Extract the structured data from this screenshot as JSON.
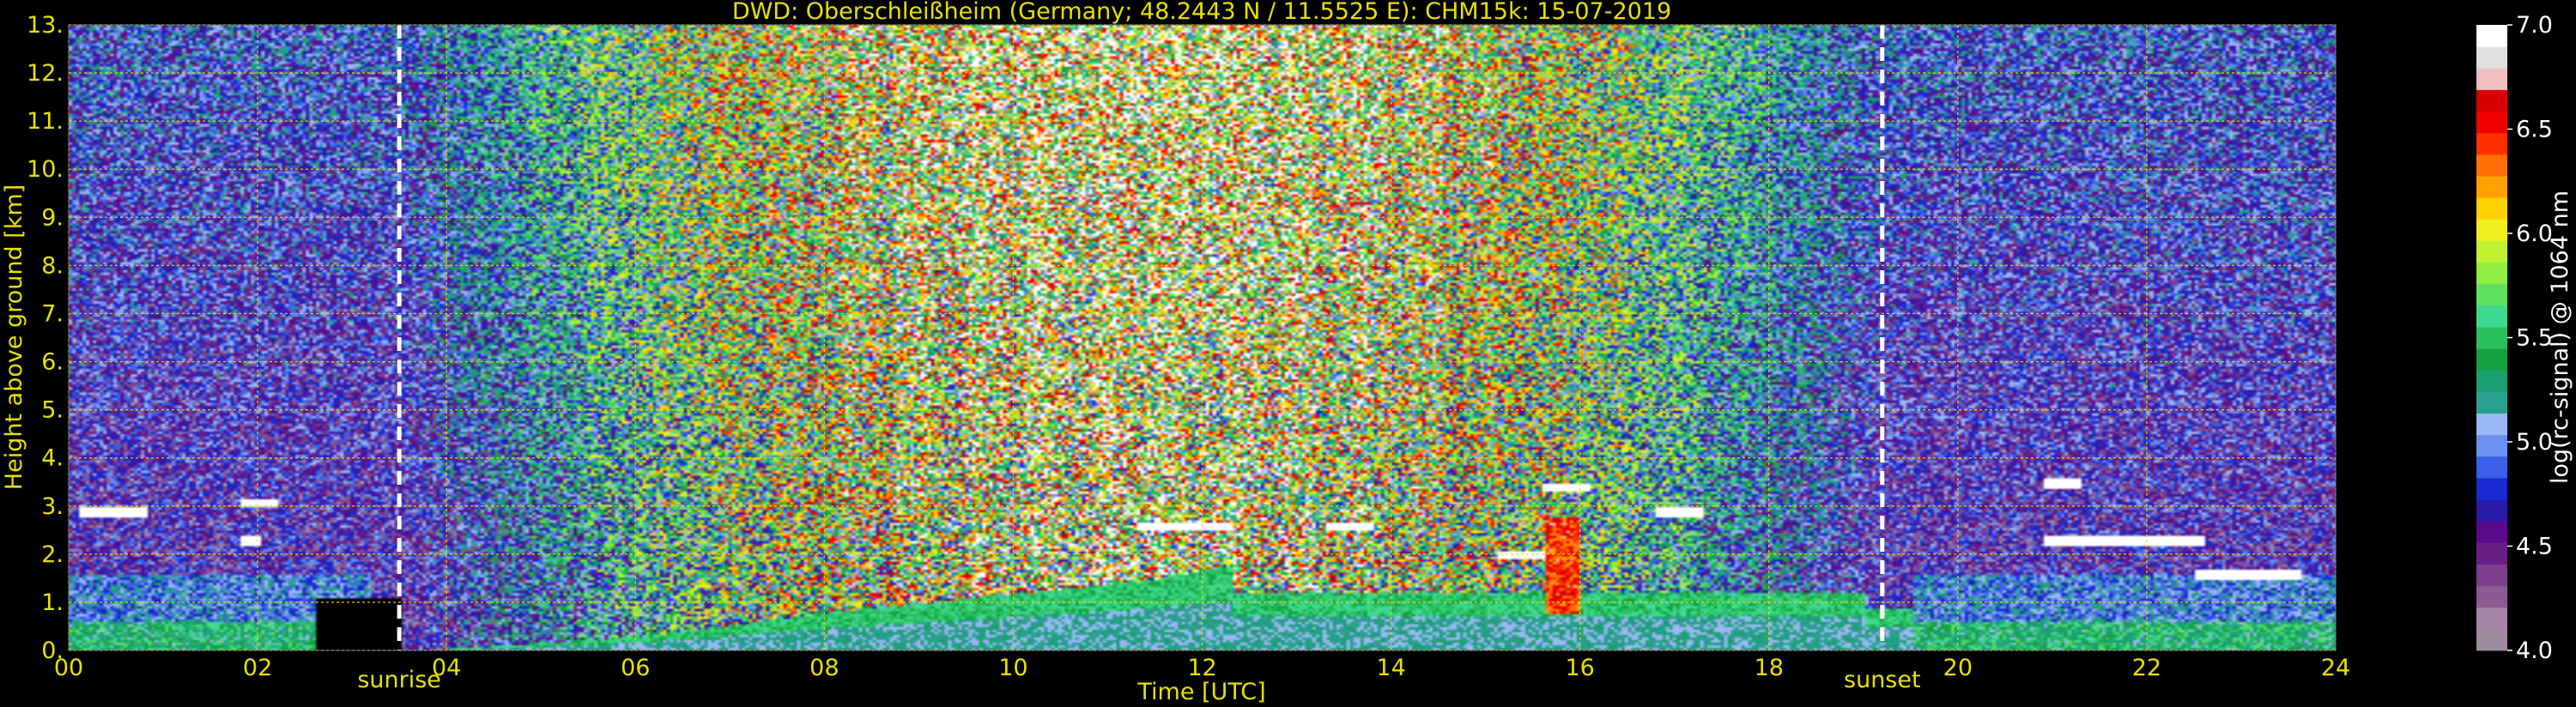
{
  "chart_data": [
    {
      "type": "heatmap",
      "title": "DWD: Oberschleißheim (Germany; 48.2443 N / 11.5525 E):    CHM15k: 15-07-2019",
      "xlabel": "Time [UTC]",
      "ylabel": "Height above ground [km]",
      "xlim": [
        0,
        24
      ],
      "ylim": [
        0,
        13
      ],
      "x_ticks": [
        "00",
        "02",
        "04",
        "06",
        "08",
        "10",
        "12",
        "14",
        "16",
        "18",
        "20",
        "22",
        "24"
      ],
      "y_ticks": [
        "0.",
        "1.",
        "2.",
        "3.",
        "4.",
        "5.",
        "6.",
        "7.",
        "8.",
        "9.",
        "10.",
        "11.",
        "12.",
        "13."
      ],
      "grid": true,
      "grid_color": "#e8e000",
      "markers": [
        {
          "label": "sunrise",
          "time": 3.5
        },
        {
          "label": "sunset",
          "time": 19.2
        }
      ],
      "colorbar": {
        "label": "log(rc-signal) @ 1064 nm",
        "range": [
          4.0,
          7.0
        ],
        "ticks": [
          "4.0",
          "4.5",
          "5.0",
          "5.5",
          "6.0",
          "6.5",
          "7.0"
        ],
        "colors": [
          "#9e8a9c",
          "#a685a6",
          "#8c5a93",
          "#7d3f8c",
          "#6a1f86",
          "#5a0a8a",
          "#2a1aa8",
          "#1a2ad4",
          "#3a60e8",
          "#6a90f0",
          "#9ab8f4",
          "#2aa090",
          "#1a9f70",
          "#15a040",
          "#2ac060",
          "#40d890",
          "#60e060",
          "#90ee40",
          "#c0f030",
          "#f0f020",
          "#ffd000",
          "#ffa000",
          "#ff7000",
          "#ff3000",
          "#f00000",
          "#d80000",
          "#f0c0c0",
          "#e0e0e0",
          "#ffffff"
        ]
      },
      "features": {
        "boundary_layer_top_km": [
          {
            "time": 4.0,
            "height": 0.05
          },
          {
            "time": 6.0,
            "height": 0.3
          },
          {
            "time": 8.0,
            "height": 0.8
          },
          {
            "time": 10.0,
            "height": 1.2
          },
          {
            "time": 11.5,
            "height": 1.5
          },
          {
            "time": 12.3,
            "height": 1.8
          }
        ],
        "cloud_layers": [
          {
            "start": 0.1,
            "end": 0.8,
            "height": 2.9
          },
          {
            "start": 1.8,
            "end": 2.2,
            "height": 3.1
          },
          {
            "start": 1.8,
            "end": 2.0,
            "height": 2.3
          },
          {
            "start": 11.3,
            "end": 12.3,
            "height": 2.6
          },
          {
            "start": 13.3,
            "end": 13.8,
            "height": 2.6
          },
          {
            "start": 15.1,
            "end": 15.6,
            "height": 2.0
          },
          {
            "start": 15.6,
            "end": 16.1,
            "height": 3.4
          },
          {
            "start": 16.8,
            "end": 17.3,
            "height": 2.9
          },
          {
            "start": 20.9,
            "end": 21.3,
            "height": 3.5
          },
          {
            "start": 20.9,
            "end": 22.6,
            "height": 2.3
          },
          {
            "start": 22.5,
            "end": 23.6,
            "height": 1.6
          }
        ]
      }
    }
  ]
}
